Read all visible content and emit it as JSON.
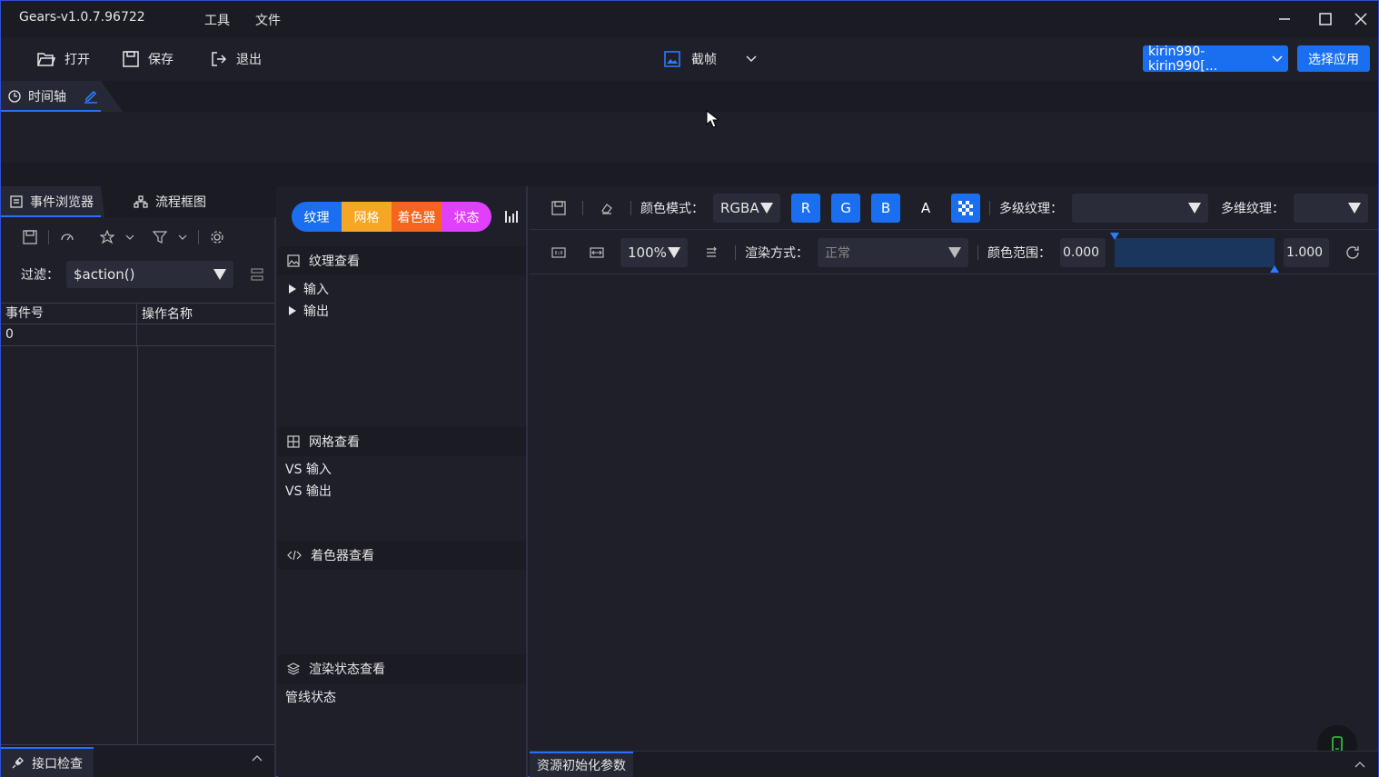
{
  "app": {
    "title": "Gears-v1.0.7.96722"
  },
  "menu": {
    "tools": "工具",
    "file": "文件"
  },
  "toolbar": {
    "open": "打开",
    "save": "保存",
    "exit": "退出",
    "capture": "截帧",
    "device": "kirin990-kirin990[...",
    "select_app": "选择应用"
  },
  "timeline": {
    "tab": "时间轴"
  },
  "left": {
    "tabs": [
      "事件浏览器",
      "流程框图"
    ],
    "filter_label": "过滤：",
    "filter_value": "$action()",
    "columns": [
      "事件号",
      "操作名称"
    ],
    "rows": [
      [
        "0",
        ""
      ]
    ],
    "bottom_tab": "接口检查"
  },
  "middle": {
    "pills": [
      {
        "label": "纹理",
        "color": "#1a6ff0"
      },
      {
        "label": "网格",
        "color": "#f5a623"
      },
      {
        "label": "着色器",
        "color": "#f5651e"
      },
      {
        "label": "状态",
        "color": "#e040fb"
      }
    ],
    "texture": {
      "title": "纹理查看",
      "items": [
        "输入",
        "输出"
      ]
    },
    "mesh": {
      "title": "网格查看",
      "items": [
        "VS 输入",
        "VS 输出"
      ]
    },
    "shader": {
      "title": "着色器查看"
    },
    "render_state": {
      "title": "渲染状态查看",
      "items": [
        "管线状态"
      ]
    }
  },
  "viewer": {
    "color_mode_label": "颜色模式：",
    "color_mode": "RGBA",
    "channels": [
      "R",
      "G",
      "B",
      "A"
    ],
    "mip_label": "多级纹理：",
    "mip_value": "",
    "layer_label": "多维纹理：",
    "layer_value": "",
    "zoom": "100%",
    "render_mode_label": "渲染方式：",
    "render_mode": "正常",
    "range_label": "颜色范围：",
    "range_min": "0.000",
    "range_max": "1.000",
    "bottom_tab": "资源初始化参数"
  },
  "colors": {
    "accent": "#1a6ff0",
    "bg": "#1e1f29",
    "header": "#1a1b23"
  }
}
